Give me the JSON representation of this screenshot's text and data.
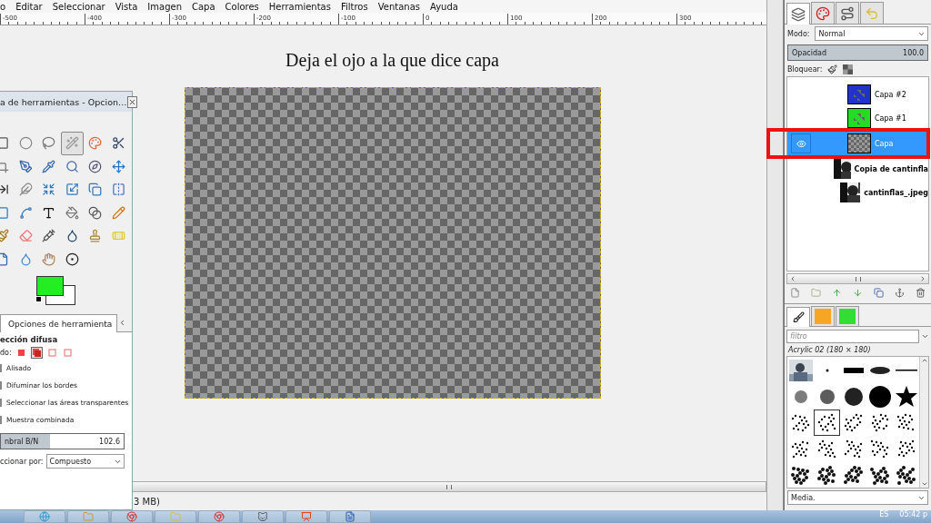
{
  "menu": [
    {
      "label": "o"
    },
    {
      "label": "Editar"
    },
    {
      "label": "Seleccionar"
    },
    {
      "label": "Vista"
    },
    {
      "label": "Imagen"
    },
    {
      "label": "Capa"
    },
    {
      "label": "Colores"
    },
    {
      "label": "Herramientas"
    },
    {
      "label": "Filtros"
    },
    {
      "label": "Ventanas"
    },
    {
      "label": "Ayuda"
    }
  ],
  "ruler": [
    "-500",
    "-400",
    "-300",
    "-200",
    "-100",
    "0",
    "100",
    "200",
    "300"
  ],
  "canvas": {
    "caption": "Deja el ojo a la que dice capa"
  },
  "status_bar": {
    "text": "3 MB)"
  },
  "toolbox": {
    "title": "a de herramientas - Opcion…",
    "tools": [
      {
        "selected": false
      },
      {
        "selected": false
      },
      {
        "selected": false
      },
      {
        "selected": true
      },
      {
        "selected": false
      },
      {
        "selected": false
      },
      {
        "selected": false
      },
      {
        "selected": false
      },
      {
        "selected": false
      },
      {
        "selected": false
      },
      {
        "selected": false
      },
      {
        "selected": false
      },
      {
        "selected": false
      },
      {
        "selected": false
      },
      {
        "selected": false
      },
      {
        "selected": false
      },
      {
        "selected": false
      },
      {
        "selected": false
      },
      {
        "selected": false
      },
      {
        "selected": false
      },
      {
        "selected": false
      },
      {
        "selected": false
      },
      {
        "selected": false
      },
      {
        "selected": false
      },
      {
        "selected": false
      },
      {
        "selected": false
      },
      {
        "selected": false
      },
      {
        "selected": false
      },
      {
        "selected": false
      },
      {
        "selected": false
      },
      {
        "selected": false
      },
      {
        "selected": false
      },
      {
        "selected": false
      },
      {
        "selected": false
      }
    ],
    "foreground": {
      "color": "#22ee22"
    },
    "background": {
      "color": "#ffffff"
    },
    "options_tab": "Opciones de herramienta",
    "tool_name": "ección difusa",
    "mode_label": "do:",
    "modes": [
      {
        "selected": false
      },
      {
        "selected": true
      },
      {
        "selected": false
      },
      {
        "selected": false
      }
    ],
    "checkboxes": [
      {
        "label": "Alisado"
      },
      {
        "label": "Difuminar los bordes"
      },
      {
        "label": "Seleccionar las áreas transparentes"
      },
      {
        "label": "Muestra combinada"
      }
    ],
    "threshold": {
      "label": "nbral B/N",
      "value": "102.6",
      "level": 0.4
    },
    "select_by": {
      "label": "ccionar por:",
      "value": "Compuesto"
    }
  },
  "layers_dock": {
    "tabs": [
      {
        "selected": true
      },
      {
        "selected": false
      },
      {
        "selected": false
      },
      {
        "selected": false
      }
    ],
    "mode": {
      "label": "Modo:",
      "value": "Normal"
    },
    "opacity": {
      "label": "Opacidad",
      "value": "100.0",
      "level": 1
    },
    "lock_label": "Bloquear:",
    "layers": [
      {
        "name": "Capa #2",
        "kind": "blue",
        "visible": false,
        "selected": false,
        "bold": false,
        "highlighted": false
      },
      {
        "name": "Capa #1",
        "kind": "green",
        "visible": false,
        "selected": false,
        "bold": false,
        "highlighted": false
      },
      {
        "name": "Capa",
        "kind": "empty",
        "visible": true,
        "selected": true,
        "bold": false,
        "highlighted": true
      },
      {
        "name": "Copia de cantinfla",
        "visible": false,
        "selected": false,
        "bold": true,
        "highlighted": false
      },
      {
        "name": "cantinflas_.jpeg",
        "visible": false,
        "selected": false,
        "bold": true,
        "highlighted": false
      }
    ]
  },
  "brushes_dock": {
    "tabs": [
      {
        "selected": true
      },
      {
        "selected": false
      },
      {
        "selected": false
      }
    ],
    "filter": {
      "placeholder": "filtro"
    },
    "brush_name": "Acrylic 02 (180 × 180)",
    "brushes": [
      {
        "selected": false
      },
      {
        "selected": false
      },
      {
        "selected": false
      },
      {
        "selected": false
      },
      {
        "selected": false
      },
      {
        "selected": false
      },
      {
        "selected": false
      },
      {
        "selected": false
      },
      {
        "selected": false
      },
      {
        "selected": false
      },
      {
        "selected": false
      },
      {
        "selected": true
      },
      {
        "selected": false
      },
      {
        "selected": false
      },
      {
        "selected": false
      },
      {
        "selected": false
      },
      {
        "selected": false
      },
      {
        "selected": false
      },
      {
        "selected": false
      },
      {
        "selected": false
      },
      {
        "selected": false
      },
      {
        "selected": false
      },
      {
        "selected": false
      },
      {
        "selected": false
      },
      {
        "selected": false
      }
    ],
    "view": {
      "value": "Media."
    }
  },
  "taskbar": {
    "language": "ES",
    "clock": "05:42 p"
  }
}
